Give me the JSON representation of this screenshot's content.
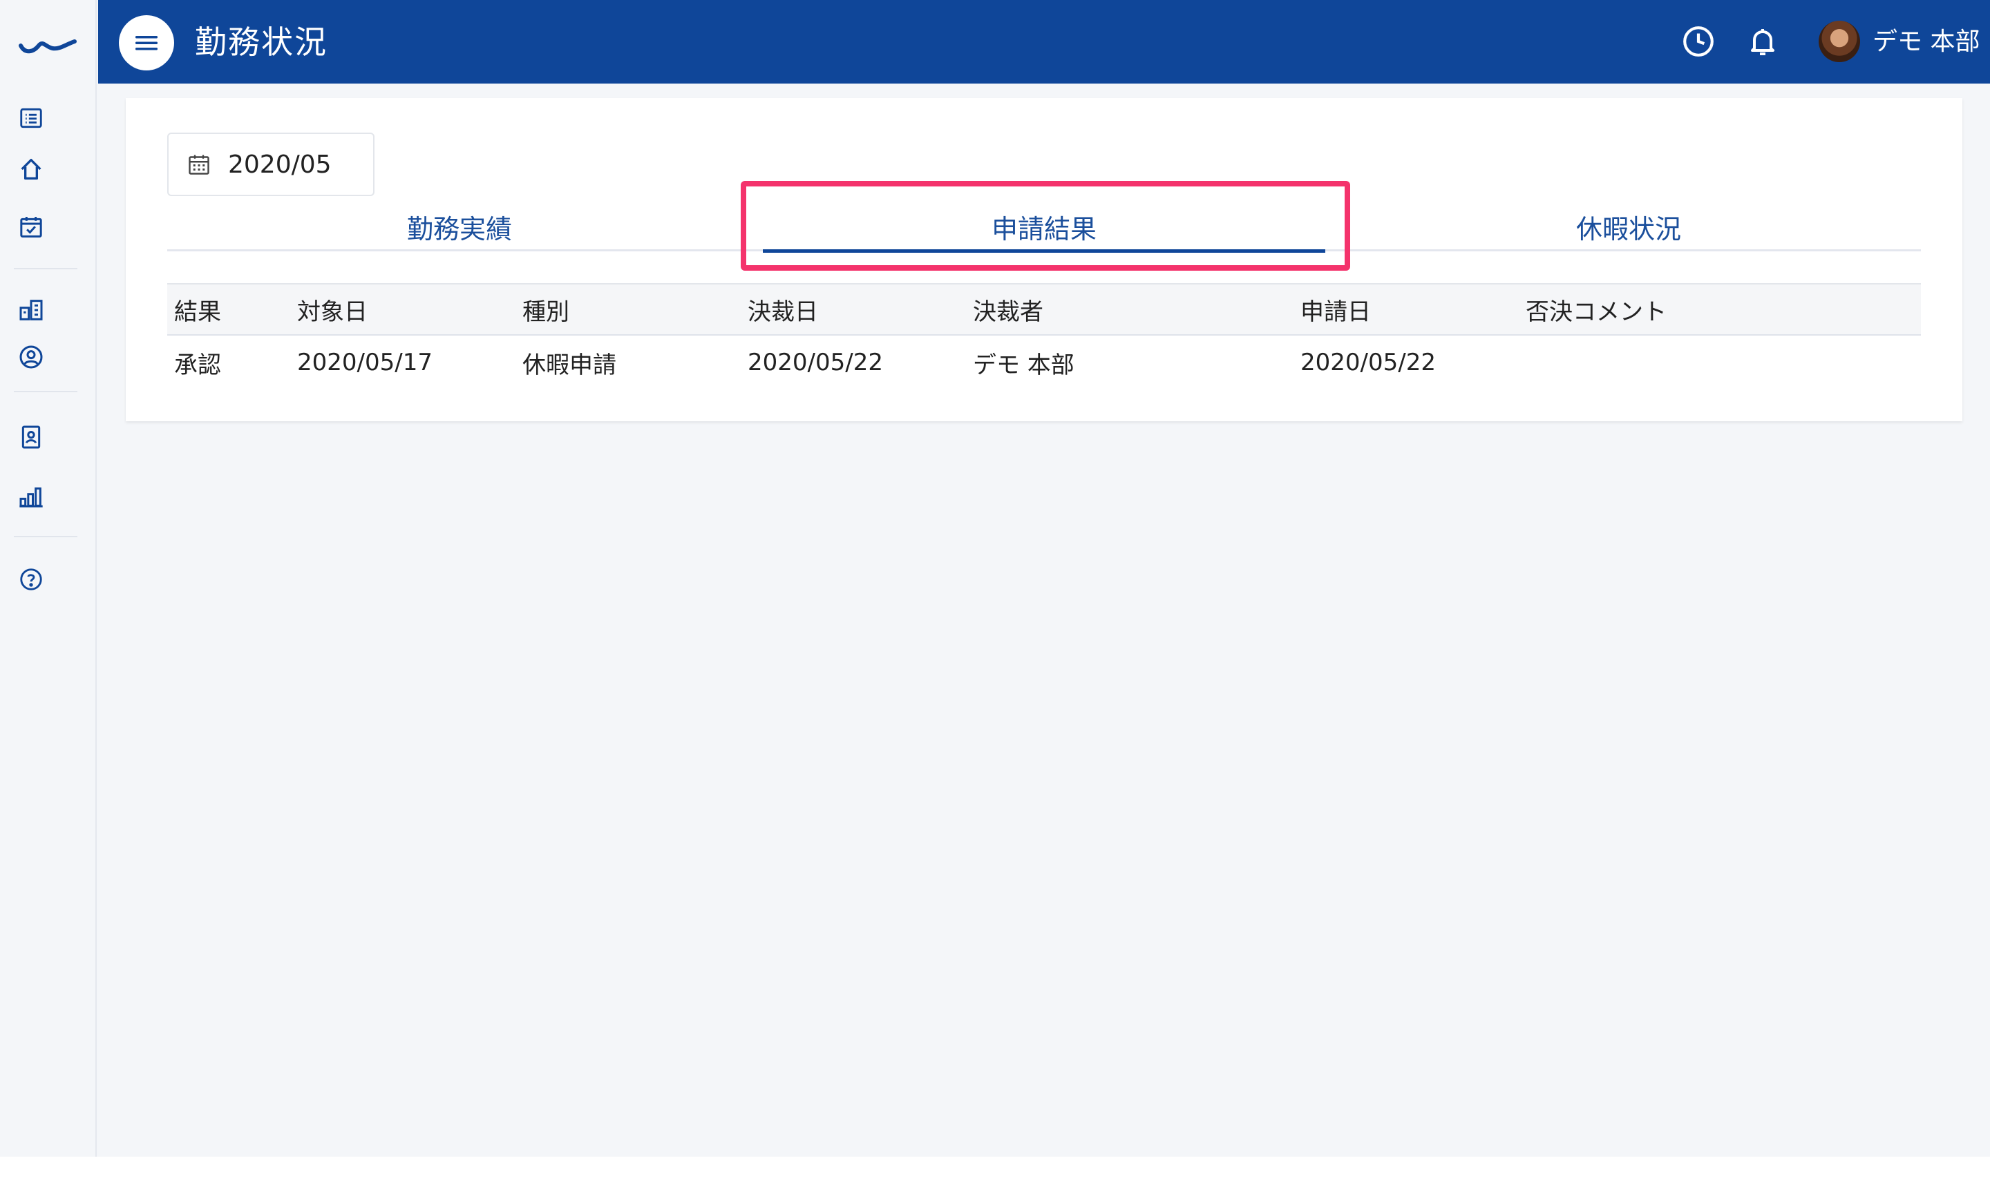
{
  "header": {
    "title": "勤務状況",
    "user_name": "デモ 本部"
  },
  "filter": {
    "month": "2020/05"
  },
  "tabs": [
    {
      "label": "勤務実績",
      "active": false
    },
    {
      "label": "申請結果",
      "active": true
    },
    {
      "label": "休暇状況",
      "active": false
    }
  ],
  "table": {
    "columns": [
      "結果",
      "対象日",
      "種別",
      "決裁日",
      "決裁者",
      "申請日",
      "否決コメント"
    ],
    "rows": [
      [
        "承認",
        "2020/05/17",
        "休暇申請",
        "2020/05/22",
        "デモ 本部",
        "2020/05/22",
        ""
      ]
    ]
  },
  "colors": {
    "brand": "#0f4699",
    "tab_text": "#1b4f9c",
    "highlight": "#f4336c",
    "background": "#f4f6f9"
  },
  "icons": {
    "rail": [
      "app-logo",
      "list-icon",
      "home-icon",
      "calendar-check-icon",
      "building-icon",
      "user-circle-icon",
      "id-badge-icon",
      "bar-chart-icon",
      "help-icon"
    ],
    "header": [
      "menu-icon",
      "clock-icon",
      "bell-icon",
      "avatar"
    ]
  }
}
